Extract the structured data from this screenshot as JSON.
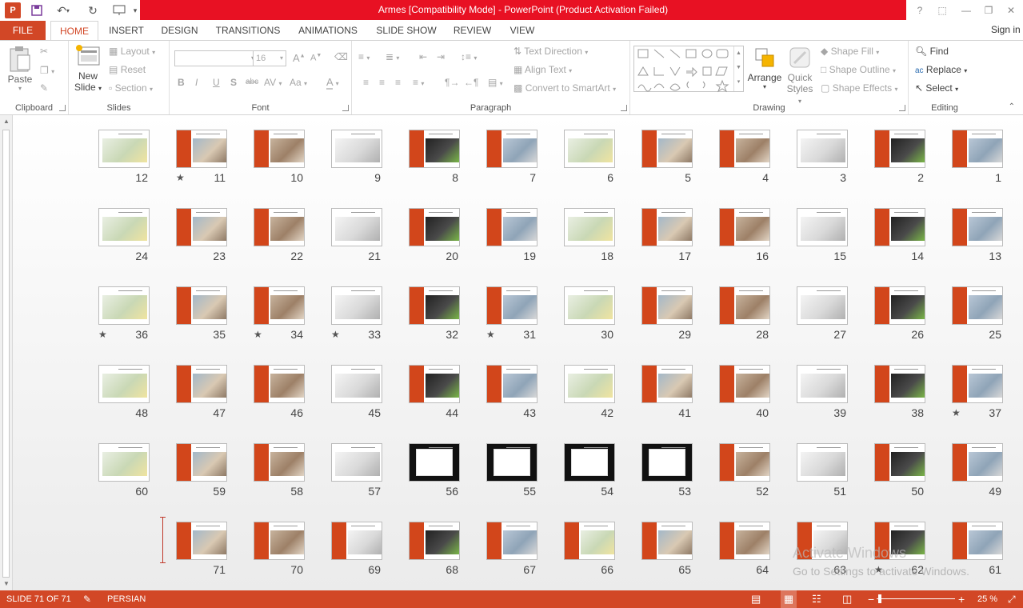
{
  "window": {
    "title": "Armes [Compatibility Mode] -  PowerPoint (Product Activation Failed)",
    "logo_letter": "P",
    "controls": {
      "help": "?",
      "ribbon_opts": "⬚",
      "minimize": "—",
      "restore": "❐",
      "close": "✕"
    }
  },
  "tabs": {
    "file": "FILE",
    "items": [
      "HOME",
      "INSERT",
      "DESIGN",
      "TRANSITIONS",
      "ANIMATIONS",
      "SLIDE SHOW",
      "REVIEW",
      "VIEW"
    ],
    "active": "HOME",
    "signin": "Sign in"
  },
  "ribbon": {
    "clipboard": {
      "label": "Clipboard",
      "paste": "Paste"
    },
    "slides": {
      "label": "Slides",
      "new_slide": "New",
      "new_slide_2": "Slide",
      "layout": "Layout",
      "reset": "Reset",
      "section": "Section"
    },
    "font": {
      "label": "Font",
      "size": "16",
      "bold": "B",
      "italic": "I",
      "underline": "U",
      "shadow": "S",
      "strike": "abc",
      "spacing": "AV",
      "case": "Aa",
      "color": "A",
      "grow": "A",
      "shrink": "A"
    },
    "paragraph": {
      "label": "Paragraph",
      "text_direction": "Text Direction",
      "align_text": "Align Text",
      "smartart": "Convert to SmartArt"
    },
    "drawing": {
      "label": "Drawing",
      "arrange": "Arrange",
      "quick": "Quick",
      "styles": "Styles",
      "shape_fill": "Shape Fill",
      "shape_outline": "Shape Outline",
      "shape_effects": "Shape Effects"
    },
    "editing": {
      "label": "Editing",
      "find": "Find",
      "replace": "Replace",
      "select": "Select"
    }
  },
  "slides": [
    {
      "n": "12",
      "star": false
    },
    {
      "n": "11",
      "star": true
    },
    {
      "n": "10",
      "star": false
    },
    {
      "n": "9",
      "star": false
    },
    {
      "n": "8",
      "star": false
    },
    {
      "n": "7",
      "star": false
    },
    {
      "n": "6",
      "star": false
    },
    {
      "n": "5",
      "star": false
    },
    {
      "n": "4",
      "star": false
    },
    {
      "n": "3",
      "star": false
    },
    {
      "n": "2",
      "star": false
    },
    {
      "n": "1",
      "star": false
    },
    {
      "n": "24",
      "star": false
    },
    {
      "n": "23",
      "star": false
    },
    {
      "n": "22",
      "star": false
    },
    {
      "n": "21",
      "star": false
    },
    {
      "n": "20",
      "star": false
    },
    {
      "n": "19",
      "star": false
    },
    {
      "n": "18",
      "star": false
    },
    {
      "n": "17",
      "star": false
    },
    {
      "n": "16",
      "star": false
    },
    {
      "n": "15",
      "star": false
    },
    {
      "n": "14",
      "star": false
    },
    {
      "n": "13",
      "star": false
    },
    {
      "n": "36",
      "star": true
    },
    {
      "n": "35",
      "star": false
    },
    {
      "n": "34",
      "star": true
    },
    {
      "n": "33",
      "star": true
    },
    {
      "n": "32",
      "star": false
    },
    {
      "n": "31",
      "star": true
    },
    {
      "n": "30",
      "star": false
    },
    {
      "n": "29",
      "star": false
    },
    {
      "n": "28",
      "star": false
    },
    {
      "n": "27",
      "star": false
    },
    {
      "n": "26",
      "star": false
    },
    {
      "n": "25",
      "star": false
    },
    {
      "n": "48",
      "star": false
    },
    {
      "n": "47",
      "star": false
    },
    {
      "n": "46",
      "star": false
    },
    {
      "n": "45",
      "star": false
    },
    {
      "n": "44",
      "star": false
    },
    {
      "n": "43",
      "star": false
    },
    {
      "n": "42",
      "star": false
    },
    {
      "n": "41",
      "star": false
    },
    {
      "n": "40",
      "star": false
    },
    {
      "n": "39",
      "star": false
    },
    {
      "n": "38",
      "star": false
    },
    {
      "n": "37",
      "star": true
    },
    {
      "n": "60",
      "star": false
    },
    {
      "n": "59",
      "star": false
    },
    {
      "n": "58",
      "star": false
    },
    {
      "n": "57",
      "star": false
    },
    {
      "n": "56",
      "star": false
    },
    {
      "n": "55",
      "star": false
    },
    {
      "n": "54",
      "star": false
    },
    {
      "n": "53",
      "star": false
    },
    {
      "n": "52",
      "star": false
    },
    {
      "n": "51",
      "star": false
    },
    {
      "n": "50",
      "star": false
    },
    {
      "n": "49",
      "star": false
    },
    {
      "n": "",
      "star": false
    },
    {
      "n": "71",
      "star": false
    },
    {
      "n": "70",
      "star": false
    },
    {
      "n": "69",
      "star": false
    },
    {
      "n": "68",
      "star": false
    },
    {
      "n": "67",
      "star": false
    },
    {
      "n": "66",
      "star": false
    },
    {
      "n": "65",
      "star": false
    },
    {
      "n": "64",
      "star": false
    },
    {
      "n": "63",
      "star": false
    },
    {
      "n": "62",
      "star": true
    },
    {
      "n": "61",
      "star": false
    }
  ],
  "watermark": {
    "line1": "Activate Windows",
    "line2": "Go to Settings to activate Windows."
  },
  "status": {
    "slide": "SLIDE 71 OF 71",
    "language": "PERSIAN",
    "zoom": "25 %"
  }
}
